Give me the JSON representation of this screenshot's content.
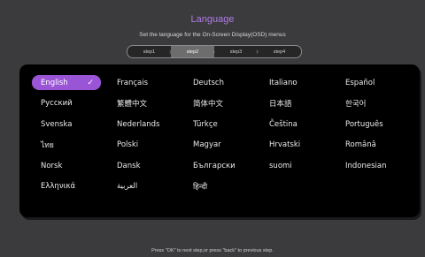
{
  "header": {
    "title": "Language",
    "subtitle": "Set the language for the On-Screen Display(OSD) menus"
  },
  "steps": [
    "step1",
    "step2",
    "step3",
    "step4"
  ],
  "languages": [
    "English",
    "Français",
    "Deutsch",
    "Italiano",
    "Español",
    "Русский",
    "繁體中文",
    "简体中文",
    "日本語",
    "한국어",
    "Svenska",
    "Nederlands",
    "Türkçe",
    "Čeština",
    "Português",
    "ไทย",
    "Polski",
    "Magyar",
    "Hrvatski",
    "Română",
    "Norsk",
    "Dansk",
    "Български",
    "suomi",
    "Indonesian",
    "Ελληνικά",
    "العربية",
    "हिन्दी"
  ],
  "selected_check": "✓",
  "footer": "Press \"OK\" to next step,or press \"back\" to previous step.",
  "colors": {
    "accent": "#9a55d6",
    "title": "#b07be6"
  }
}
